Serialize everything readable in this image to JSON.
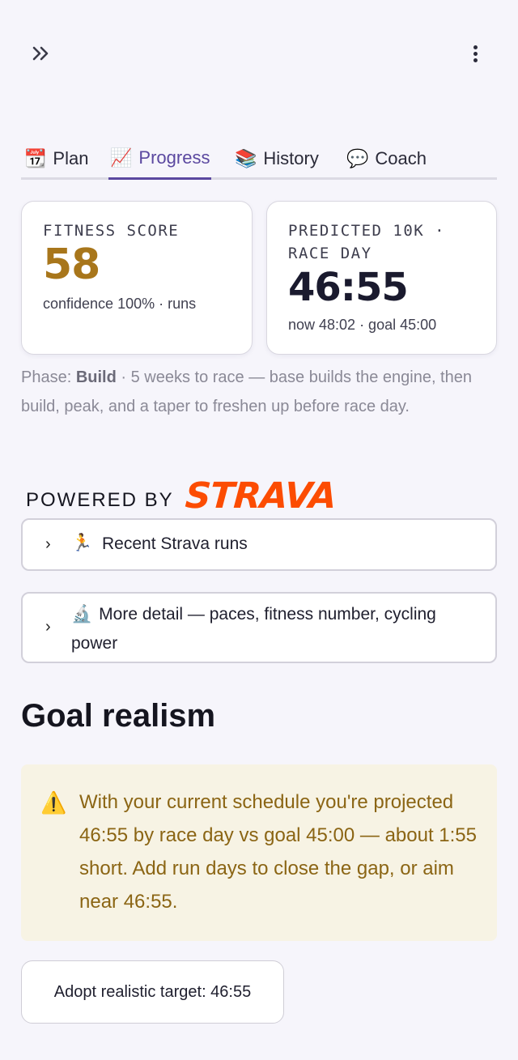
{
  "header": {
    "expand_icon": "double-chevron-right-icon",
    "menu_icon": "vertical-ellipsis-icon"
  },
  "tabs": [
    {
      "icon": "📆",
      "label": "Plan",
      "active": false
    },
    {
      "icon": "📈",
      "label": "Progress",
      "active": true
    },
    {
      "icon": "📚",
      "label": "History",
      "active": false
    },
    {
      "icon": "💬",
      "label": "Coach",
      "active": false
    }
  ],
  "fitness_card": {
    "label": "FITNESS SCORE",
    "value": "58",
    "sub": "confidence 100% · runs"
  },
  "race_card": {
    "label_line1": "PREDICTED 10K ·",
    "label_line2": "RACE DAY",
    "value": "46:55",
    "sub": "now 48:02 · goal 45:00"
  },
  "phase": {
    "prefix": "Phase: ",
    "name": "Build",
    "text": " · 5 weeks to race — base builds the engine, then build, peak, and a taper to freshen up before race day."
  },
  "strava": {
    "powered_by": "POWERED BY",
    "brand": "STRAVA",
    "brand_color": "#fc4c02"
  },
  "expanders": [
    {
      "icon": "🏃",
      "label": "Recent Strava runs"
    },
    {
      "icon": "🔬",
      "label": "More detail — paces, fitness number, cycling power"
    }
  ],
  "goal": {
    "heading": "Goal realism",
    "alert_icon": "⚠️",
    "alert_text": "With your current schedule you're projected 46:55 by race day vs goal 45:00 — about 1:55 short. Add run days to close the gap, or aim near 46:55.",
    "button_label": "Adopt realistic target: 46:55"
  }
}
